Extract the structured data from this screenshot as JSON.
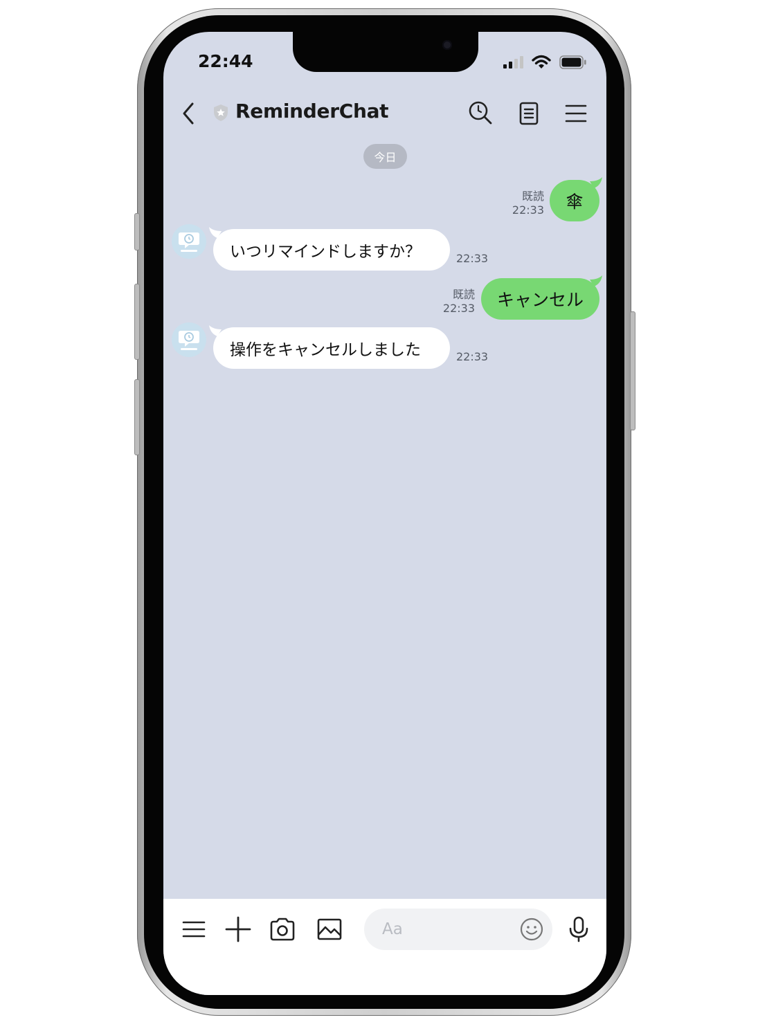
{
  "status_bar": {
    "time": "22:44"
  },
  "header": {
    "title": "ReminderChat"
  },
  "date_divider": "今日",
  "messages": [
    {
      "from": "me",
      "text": "傘",
      "read": "既読",
      "time": "22:33"
    },
    {
      "from": "bot",
      "text": "いつリマインドしますか？",
      "time": "22:33"
    },
    {
      "from": "me",
      "text": "キャンセル",
      "read": "既読",
      "time": "22:33"
    },
    {
      "from": "bot",
      "text": "操作をキャンセルしました",
      "time": "22:33"
    }
  ],
  "input": {
    "placeholder": "Aa"
  },
  "icons": {
    "header": [
      "back-chevron-icon",
      "verified-shield-icon",
      "search-icon",
      "notes-icon",
      "menu-icon"
    ],
    "bottom": [
      "menu-icon",
      "plus-icon",
      "camera-icon",
      "image-icon",
      "emoji-icon",
      "microphone-icon"
    ]
  },
  "colors": {
    "chat_bg": "#d5dae8",
    "outgoing_bubble": "#78d873",
    "incoming_bubble": "#ffffff"
  }
}
